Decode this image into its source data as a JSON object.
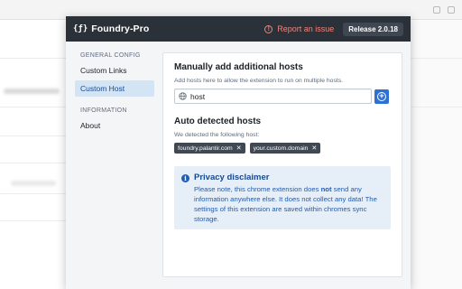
{
  "app": {
    "name": "Foundry-Pro",
    "logo_mark": "{ƒ}",
    "report_label": "Report an issue",
    "release_label": "Release 2.0.18"
  },
  "sidebar": {
    "general_heading": "GENERAL CONFIG",
    "general_items": [
      {
        "label": "Custom Links",
        "active": false
      },
      {
        "label": "Custom Host",
        "active": true
      }
    ],
    "info_heading": "INFORMATION",
    "info_items": [
      {
        "label": "About",
        "active": false
      }
    ]
  },
  "manual_hosts": {
    "title": "Manually add additional hosts",
    "description": "Add hosts here to allow the extension to run on multiple hosts.",
    "input_value": "host",
    "add_icon": "plus-circle-icon"
  },
  "auto_hosts": {
    "title": "Auto detected hosts",
    "description": "We detected the following host:",
    "hosts": [
      "foundry.palantir.com",
      "your.custom.domain"
    ]
  },
  "privacy": {
    "title": "Privacy disclaimer",
    "text_before_bold": "Please note, this chrome extension does ",
    "bold_word": "not",
    "text_after_bold": " send any information anywhere else. It does not collect any data! The settings of this extension are saved within chromes sync storage."
  },
  "colors": {
    "header_bg": "#2a3139",
    "accent_blue": "#2d72d2",
    "report_red": "#f0857a",
    "callout_bg": "#e6eef8",
    "tag_bg": "#404854"
  }
}
